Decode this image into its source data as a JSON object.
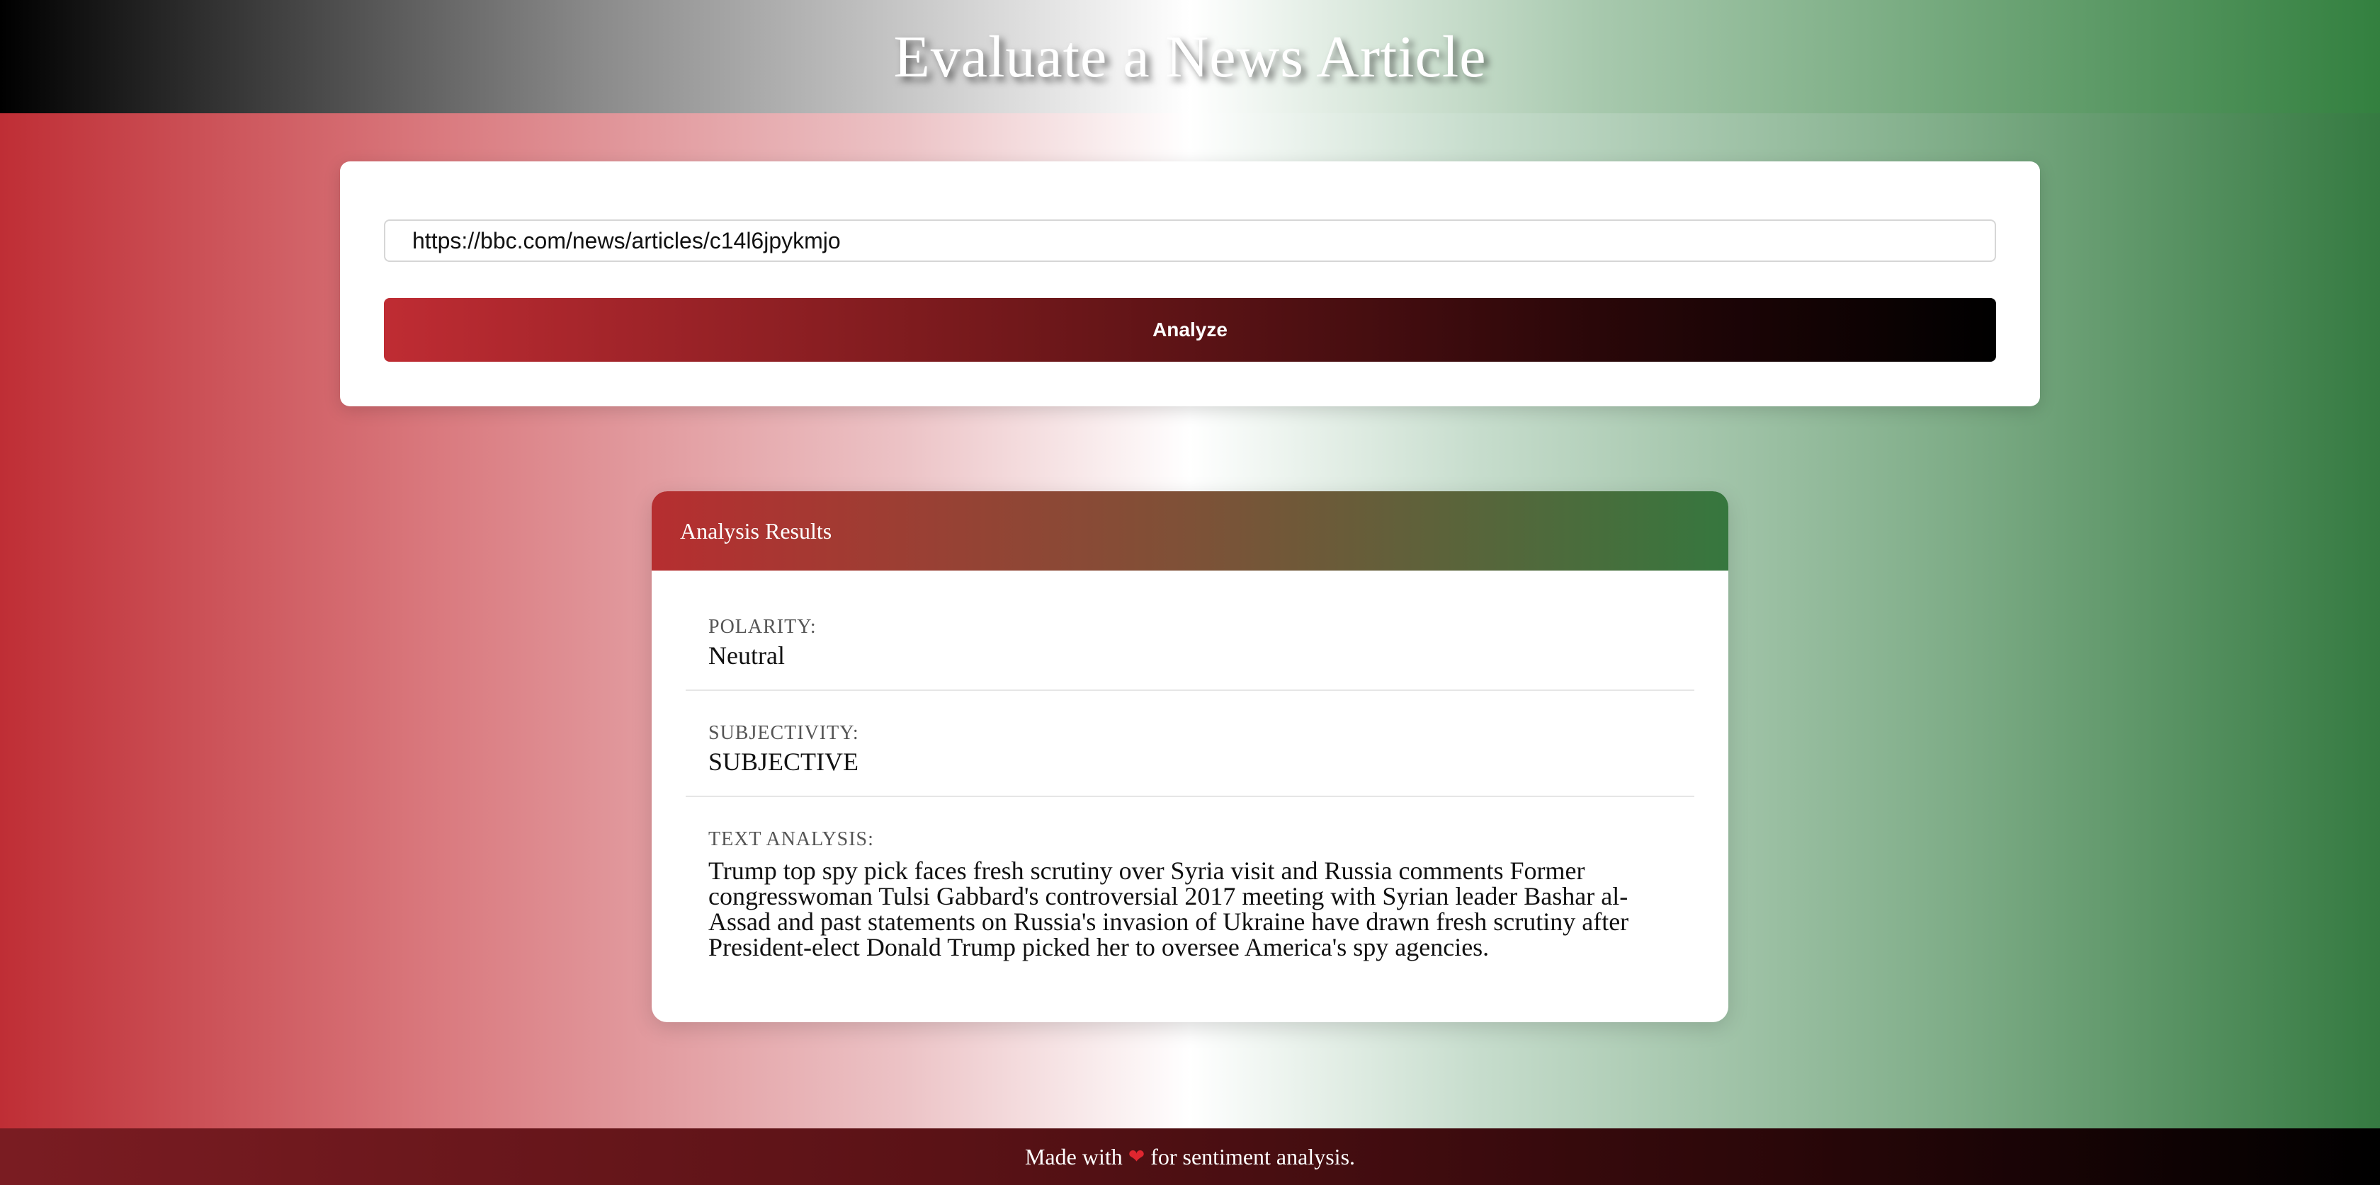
{
  "header": {
    "title": "Evaluate a News Article"
  },
  "form": {
    "url_value": "https://bbc.com/news/articles/c14l6jpykmjo",
    "analyze_label": "Analyze"
  },
  "results": {
    "title": "Analysis Results",
    "polarity_label": "POLARITY:",
    "polarity_value": "Neutral",
    "subjectivity_label": "SUBJECTIVITY:",
    "subjectivity_value": "SUBJECTIVE",
    "text_label": "TEXT ANALYSIS:",
    "text_value": "Trump top spy pick faces fresh scrutiny over Syria visit and Russia comments Former congresswoman Tulsi Gabbard's controversial 2017 meeting with Syrian leader Bashar al-Assad and past statements on Russia's invasion of Ukraine have drawn fresh scrutiny after President-elect Donald Trump picked her to oversee America's spy agencies."
  },
  "footer": {
    "prefix": "Made with",
    "heart_icon": "heart-icon",
    "heart_glyph": "❤",
    "suffix": "for sentiment analysis."
  },
  "colors": {
    "brand_red": "#bf2e35",
    "brand_green": "#357a41"
  }
}
